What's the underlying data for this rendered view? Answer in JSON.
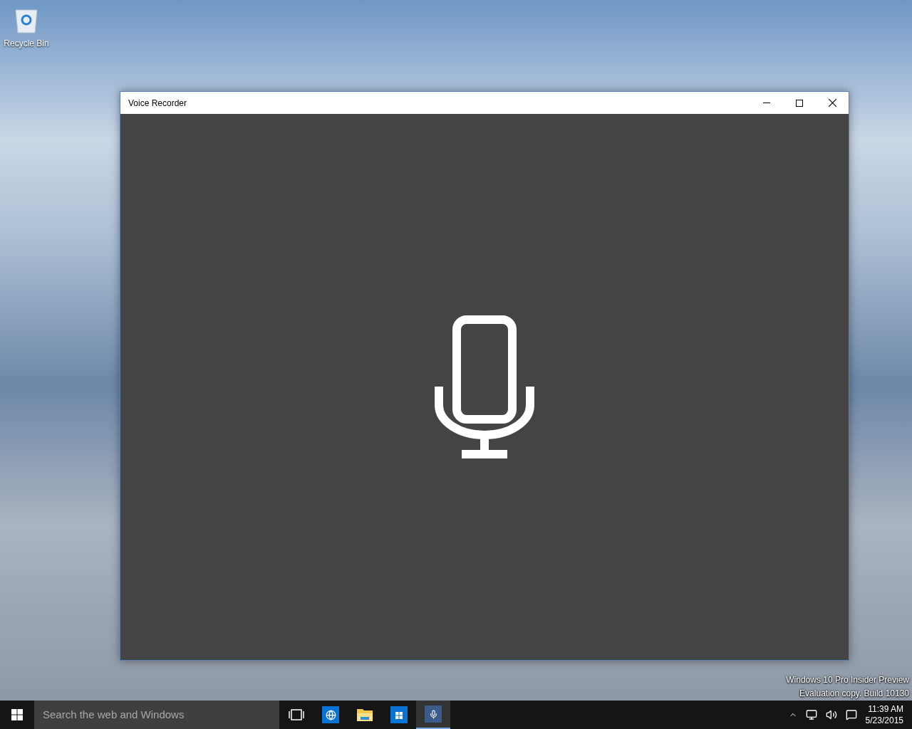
{
  "desktop": {
    "icons": [
      {
        "label": "Recycle Bin"
      }
    ],
    "watermark": [
      "Windows 10 Pro Insider Preview",
      "Evaluation copy. Build 10130"
    ]
  },
  "window": {
    "title": "Voice Recorder"
  },
  "taskbar": {
    "search": {
      "placeholder": "Search the web and Windows"
    },
    "apps": [
      {
        "kind": "taskview",
        "selected": false
      },
      {
        "kind": "browser",
        "selected": false
      },
      {
        "kind": "explorer",
        "selected": false
      },
      {
        "kind": "store",
        "selected": false
      },
      {
        "kind": "recorder",
        "selected": true
      }
    ],
    "clock": {
      "time": "11:39 AM",
      "date": "5/23/2015"
    }
  }
}
